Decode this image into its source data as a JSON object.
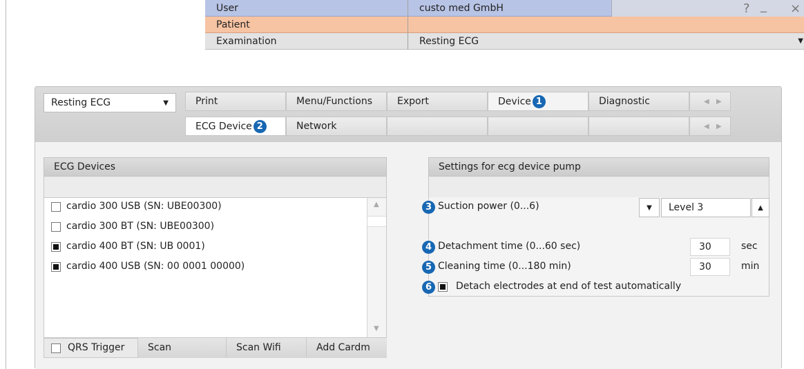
{
  "header": {
    "user_label": "User",
    "user_value": "custo med GmbH",
    "help_glyph": "?",
    "minimize_glyph": "_",
    "close_glyph": "×",
    "patient_label": "Patient",
    "patient_value": "",
    "examination_label": "Examination",
    "examination_value": "Resting ECG",
    "colors": {
      "user_row": "#b8c4e6",
      "patient_row": "#f6c3a3",
      "examination_row": "#e3e3e3"
    }
  },
  "toolbar": {
    "module_select": "Resting ECG",
    "tabs_row1": [
      "Print",
      "Menu/Functions",
      "Export",
      "Device",
      "Diagnostic"
    ],
    "tabs_row2": [
      "ECG Device",
      "Network"
    ],
    "device_badge": "1",
    "ecg_device_badge": "2"
  },
  "ecg_devices": {
    "title": "ECG Devices",
    "items": [
      {
        "label": "cardio 300 USB (SN: UBE00300)",
        "checked": false
      },
      {
        "label": "cardio 300 BT (SN: UBE00300)",
        "checked": false
      },
      {
        "label": "cardio 400 BT (SN: UB 0001)",
        "checked": true
      },
      {
        "label": "cardio 400 USB (SN: 00 0001 00000)",
        "checked": true
      }
    ],
    "qrs_trigger_label": "QRS Trigger",
    "scan_label": "Scan",
    "scan_wifi_label": "Scan Wifi",
    "add_cardm_label": "Add Cardm"
  },
  "pump_settings": {
    "title": "Settings for ecg device pump",
    "suction_badge": "3",
    "suction_label": "Suction power (0...6)",
    "suction_value": "Level 3",
    "detachment_badge": "4",
    "detachment_label": "Detachment time (0...60 sec)",
    "detachment_value": "30",
    "detachment_unit": "sec",
    "cleaning_badge": "5",
    "cleaning_label": "Cleaning time (0...180 min)",
    "cleaning_value": "30",
    "cleaning_unit": "min",
    "detach_badge": "6",
    "detach_label": "Detach electrodes at end of test automatically",
    "detach_checked": true
  },
  "accent_badge_color": "#1767b3"
}
